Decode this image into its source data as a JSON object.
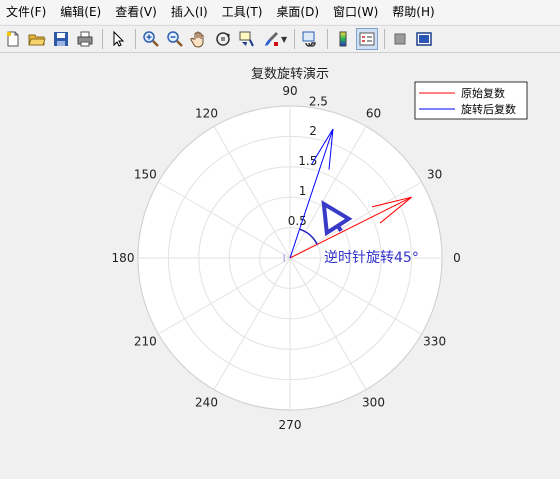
{
  "menu": [
    {
      "label": "文件(F)"
    },
    {
      "label": "编辑(E)"
    },
    {
      "label": "查看(V)"
    },
    {
      "label": "插入(I)"
    },
    {
      "label": "工具(T)"
    },
    {
      "label": "桌面(D)"
    },
    {
      "label": "窗口(W)"
    },
    {
      "label": "帮助(H)"
    }
  ],
  "toolbar": {
    "icons": [
      "new-file-icon",
      "open-folder-icon",
      "save-icon",
      "print-icon",
      "pointer-icon",
      "zoom-in-icon",
      "zoom-out-icon",
      "pan-hand-icon",
      "rotate-3d-icon",
      "data-cursor-icon",
      "brush-icon",
      "link-plot-icon",
      "colorbar-icon",
      "legend-icon",
      "hide-plot-tools-icon",
      "show-plot-tools-icon"
    ]
  },
  "chart_data": {
    "type": "polar-compass",
    "title": "复数旋转演示",
    "theta_ticks": [
      "0",
      "30",
      "60",
      "90",
      "120",
      "150",
      "180",
      "210",
      "240",
      "270",
      "300",
      "330"
    ],
    "r_ticks": [
      "0.5",
      "1",
      "1.5",
      "2",
      "2.5"
    ],
    "rlim": [
      0,
      2.5
    ],
    "grid": true,
    "series": [
      {
        "name": "原始复数",
        "color": "#ff0000",
        "r": 2.236,
        "theta_deg": 26.57
      },
      {
        "name": "旋转后复数",
        "color": "#0000ff",
        "r": 2.236,
        "theta_deg": 71.57
      }
    ],
    "annotation": {
      "text": "逆时针旋转45°",
      "color": "#3333cc"
    },
    "legend_position": "top-right"
  }
}
